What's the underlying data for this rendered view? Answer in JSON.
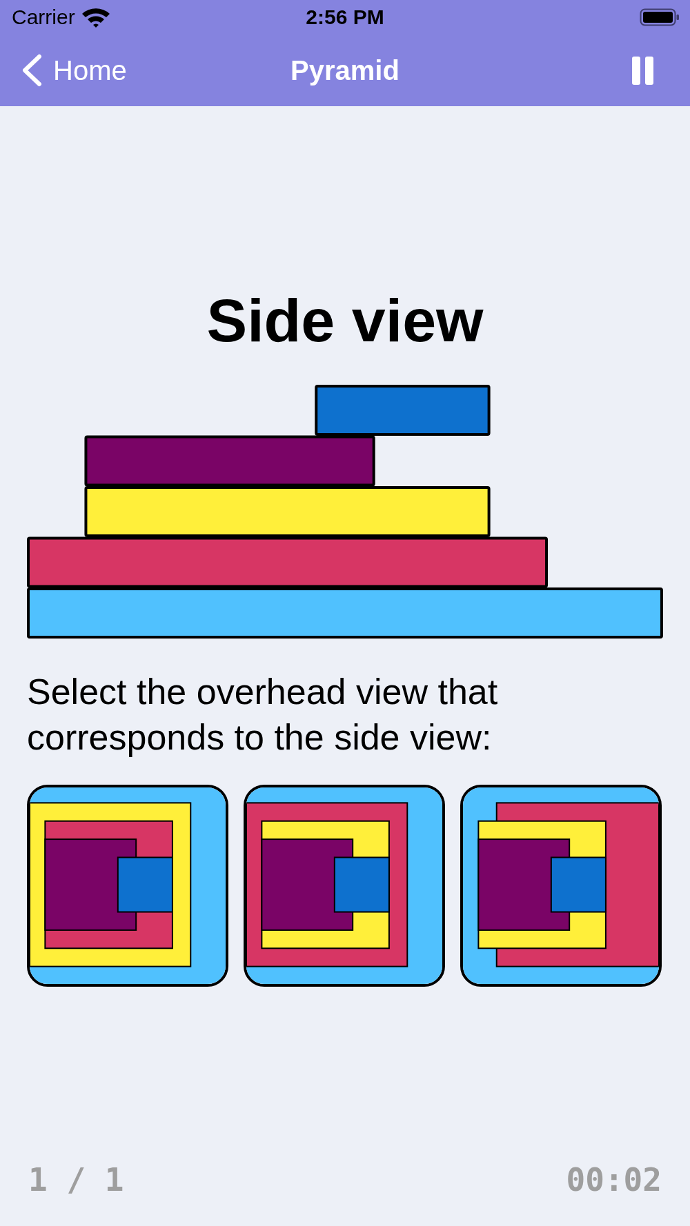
{
  "status_bar": {
    "carrier": "Carrier",
    "time": "2:56 PM"
  },
  "nav_bar": {
    "back_label": "Home",
    "title": "Pyramid"
  },
  "side_view": {
    "title": "Side view",
    "blocks": [
      {
        "color": "#0e71ce"
      },
      {
        "color": "#7a0466"
      },
      {
        "color": "#ffef3a"
      },
      {
        "color": "#d73664"
      },
      {
        "color": "#50c1fe"
      }
    ]
  },
  "prompt": "Select the overhead view that corresponds to the side view:",
  "options": [
    {
      "selected": false,
      "layers": [
        {
          "color": "#50c1fe"
        },
        {
          "color": "#ffef3a"
        },
        {
          "color": "#d73664"
        },
        {
          "color": "#7a0466"
        },
        {
          "color": "#0e71ce"
        }
      ]
    },
    {
      "selected": false,
      "layers": [
        {
          "color": "#50c1fe"
        },
        {
          "color": "#d73664"
        },
        {
          "color": "#ffef3a"
        },
        {
          "color": "#7a0466"
        },
        {
          "color": "#0e71ce"
        }
      ]
    },
    {
      "selected": false,
      "layers": [
        {
          "color": "#50c1fe"
        },
        {
          "color": "#d73664"
        },
        {
          "color": "#ffef3a"
        },
        {
          "color": "#7a0466"
        },
        {
          "color": "#0e71ce"
        }
      ]
    }
  ],
  "footer": {
    "progress": "1 / 1",
    "timer": "00:02"
  }
}
